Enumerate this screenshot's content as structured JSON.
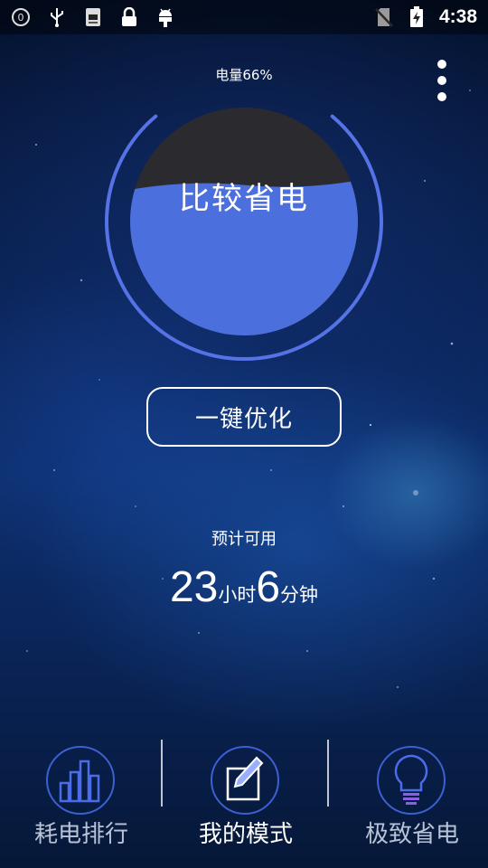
{
  "status_bar": {
    "time": "4:38",
    "left_icons": [
      "notification-count-icon",
      "usb-icon",
      "log-icon",
      "lock-icon",
      "android-debug-icon"
    ],
    "right_icons": [
      "no-sim-icon",
      "battery-charging-icon"
    ],
    "notification_count": "0"
  },
  "gauge": {
    "battery_label": "电量66%",
    "battery_percent": 66,
    "mode_title": "比较省电"
  },
  "optimize_button": {
    "label": "一键优化"
  },
  "estimate": {
    "label": "预计可用",
    "hours": "23",
    "hours_unit": "小时",
    "minutes": "6",
    "minutes_unit": "分钟"
  },
  "bottom_nav": {
    "items": [
      {
        "label": "耗电排行",
        "icon": "bar-chart-icon",
        "active": false
      },
      {
        "label": "我的模式",
        "icon": "edit-note-icon",
        "active": true
      },
      {
        "label": "极致省电",
        "icon": "lightbulb-icon",
        "active": false
      }
    ]
  },
  "colors": {
    "accent": "#4a70e0",
    "ring": "#5572e6",
    "fill": "#4b6fdc",
    "empty": "#2a2a2e",
    "nav_inactive": "#b9c3d6",
    "nav_active": "#ffffff"
  }
}
